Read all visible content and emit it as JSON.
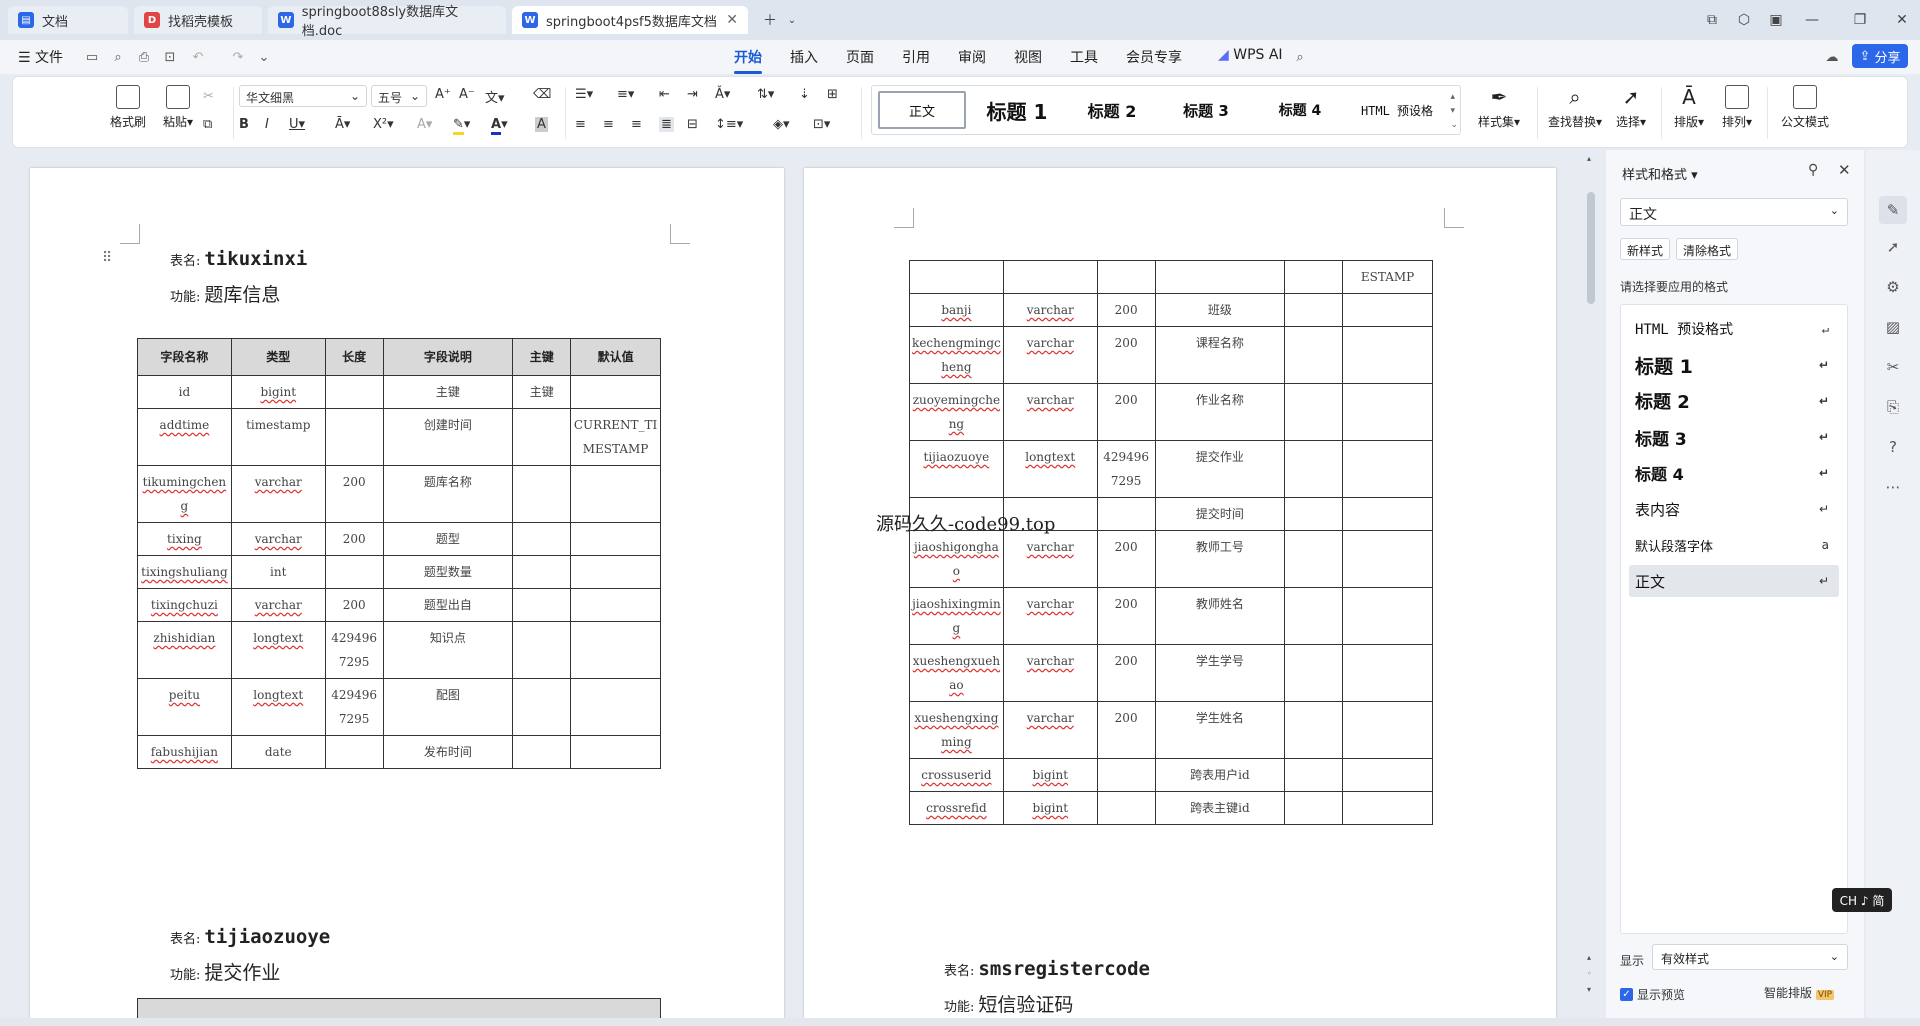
{
  "tabs": [
    {
      "label": "文档",
      "icon": "wps-home-icon",
      "color": "#2b67e8"
    },
    {
      "label": "找稻壳模板",
      "icon": "docer-icon",
      "color": "#e04646"
    },
    {
      "label": "springboot88sly数据库文档.doc",
      "icon": "word-doc-icon",
      "color": "#2b67e8"
    },
    {
      "label": "springboot4psf5数据库文档",
      "icon": "word-doc-icon",
      "color": "#2b67e8",
      "active": true
    }
  ],
  "menu": {
    "file": "文件",
    "items": [
      "开始",
      "插入",
      "页面",
      "引用",
      "审阅",
      "视图",
      "工具",
      "会员专享"
    ],
    "active": "开始",
    "wps_ai": "WPS AI",
    "share": "分享"
  },
  "ribbon": {
    "format_painter": "格式刷",
    "paste": "粘贴",
    "font_name": "华文细黑",
    "font_size": "五号",
    "styles": [
      "正文",
      "标题 1",
      "标题 2",
      "标题 3",
      "标题 4",
      "HTML 预设格"
    ],
    "style_set": "样式集",
    "find_replace": "查找替换",
    "select": "选择",
    "layout": "排版",
    "arrange": "排列",
    "official_doc": "公文模式"
  },
  "doc_left": {
    "table1": {
      "name_label": "表名:",
      "name": "tikuxinxi",
      "func_label": "功能:",
      "func": "题库信息",
      "headers": [
        "字段名称",
        "类型",
        "长度",
        "字段说明",
        "主键",
        "默认值"
      ],
      "rows": [
        [
          "id",
          "bigint",
          "",
          "主键",
          "主键",
          ""
        ],
        [
          "addtime",
          "timestamp",
          "",
          "创建时间",
          "",
          "CURRENT_TIMESTAMP"
        ],
        [
          "tikumingcheng",
          "varchar",
          "200",
          "题库名称",
          "",
          ""
        ],
        [
          "tixing",
          "varchar",
          "200",
          "题型",
          "",
          ""
        ],
        [
          "tixingshuliang",
          "int",
          "",
          "题型数量",
          "",
          ""
        ],
        [
          "tixingchuzi",
          "varchar",
          "200",
          "题型出自",
          "",
          ""
        ],
        [
          "zhishidian",
          "longtext",
          "4294967295",
          "知识点",
          "",
          ""
        ],
        [
          "peitu",
          "longtext",
          "4294967295",
          "配图",
          "",
          ""
        ],
        [
          "fabushijian",
          "date",
          "",
          "发布时间",
          "",
          ""
        ]
      ]
    },
    "table2": {
      "name_label": "表名:",
      "name": "tijiaozuoye",
      "func_label": "功能:",
      "func": "提交作业"
    }
  },
  "doc_right": {
    "header_row": [
      "",
      "",
      "",
      "",
      "",
      "ESTAMP"
    ],
    "rows": [
      [
        "banji",
        "varchar",
        "200",
        "班级",
        "",
        ""
      ],
      [
        "kechengmingcheng",
        "varchar",
        "200",
        "课程名称",
        "",
        ""
      ],
      [
        "zuoyemingcheng",
        "varchar",
        "200",
        "作业名称",
        "",
        ""
      ],
      [
        "tijiaozuoye",
        "longtext",
        "4294967295",
        "提交作业",
        "",
        ""
      ],
      [
        "",
        "",
        "",
        "提交时间",
        "",
        ""
      ],
      [
        "jiaoshigonghao",
        "varchar",
        "200",
        "教师工号",
        "",
        ""
      ],
      [
        "jiaoshixingming",
        "varchar",
        "200",
        "教师姓名",
        "",
        ""
      ],
      [
        "xueshengxuehao",
        "varchar",
        "200",
        "学生学号",
        "",
        ""
      ],
      [
        "xueshengxingming",
        "varchar",
        "200",
        "学生姓名",
        "",
        ""
      ],
      [
        "crossuserid",
        "bigint",
        "",
        "跨表用户id",
        "",
        ""
      ],
      [
        "crossrefid",
        "bigint",
        "",
        "跨表主键id",
        "",
        ""
      ]
    ],
    "watermark": "源码久久-code99.top",
    "table3": {
      "name_label": "表名:",
      "name": "smsregistercode",
      "func_label": "功能:",
      "func": "短信验证码"
    }
  },
  "pane": {
    "title": "样式和格式",
    "current_style": "正文",
    "new_style": "新样式",
    "clear_format": "清除格式",
    "prompt": "请选择要应用的格式",
    "styles": [
      "HTML 预设格式",
      "标题 1",
      "标题 2",
      "标题 3",
      "标题 4",
      "表内容",
      "默认段落字体",
      "正文"
    ],
    "show_label": "显示",
    "show_value": "有效样式",
    "preview_label": "显示预览",
    "smart_layout": "智能排版"
  },
  "ime": "CH ♪ 简"
}
